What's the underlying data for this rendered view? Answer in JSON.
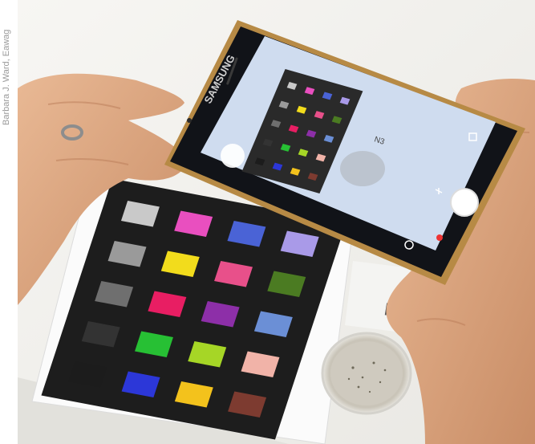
{
  "photo_credit": "Barbara J. Ward, Eawag",
  "phone": {
    "brand": "SAMSUNG",
    "screen_label": "N3"
  },
  "sample_label": "N3",
  "color_chart": {
    "rows": [
      [
        "#c9c9c9",
        "#e94fbf",
        "#4a63d6",
        "#a99ae8"
      ],
      [
        "#9a9a9a",
        "#f2dc1c",
        "#e8508a",
        "#4b7b22"
      ],
      [
        "#6f6f6f",
        "#e81e63",
        "#8d2fa8",
        "#6b8fd6"
      ],
      [
        "#333333",
        "#27c034",
        "#a6d626",
        "#f1b3a8"
      ],
      [
        "#1c1c1c",
        "#2c37d8",
        "#f3c21c",
        "#7d3b30"
      ]
    ]
  },
  "colors": {
    "table": "#f3f2ee",
    "card_black": "#1d1d1d",
    "phone_body": "#b78a45",
    "screen_bg": "#cfdcef",
    "skin": "#e0ac86"
  }
}
